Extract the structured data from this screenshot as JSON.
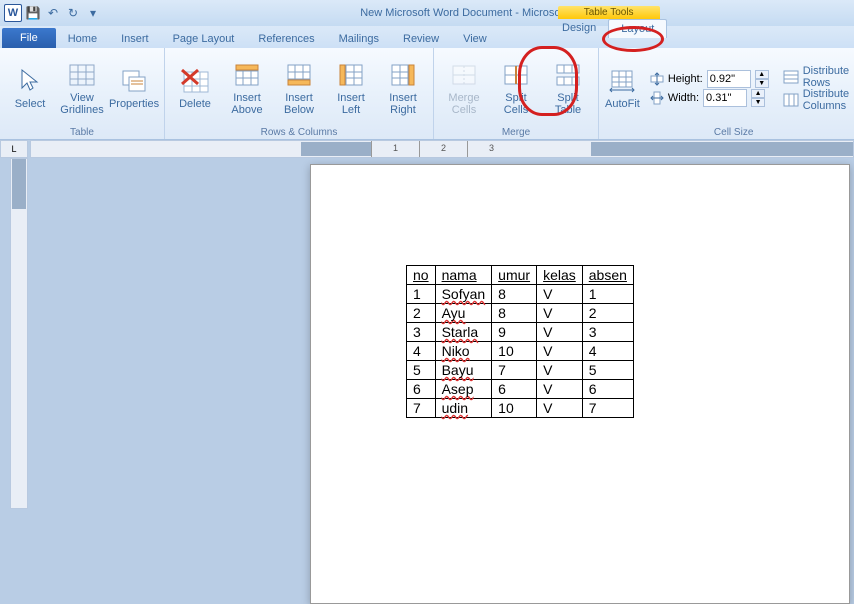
{
  "title": "New Microsoft Word Document  -  Microsoft Word",
  "context_tab_label": "Table Tools",
  "tabs": {
    "file": "File",
    "home": "Home",
    "insert": "Insert",
    "pagelayout": "Page Layout",
    "references": "References",
    "mailings": "Mailings",
    "review": "Review",
    "view": "View",
    "design": "Design",
    "layout": "Layout"
  },
  "ribbon": {
    "select": "Select",
    "gridlines": "View Gridlines",
    "properties": "Properties",
    "delete": "Delete",
    "ins_above": "Insert Above",
    "ins_below": "Insert Below",
    "ins_left": "Insert Left",
    "ins_right": "Insert Right",
    "merge": "Merge Cells",
    "split_cells": "Split Cells",
    "split_table": "Split Table",
    "autofit": "AutoFit",
    "height_lbl": "Height:",
    "width_lbl": "Width:",
    "height_val": "0.92\"",
    "width_val": "0.31\"",
    "dist_rows": "Distribute Rows",
    "dist_cols": "Distribute Columns",
    "g_table": "Table",
    "g_rows": "Rows & Columns",
    "g_merge": "Merge",
    "g_size": "Cell Size"
  },
  "ruler": {
    "t1": "1",
    "t2": "2",
    "t3": "3"
  },
  "doc": {
    "headers": [
      "no",
      "nama",
      "umur",
      "kelas",
      "absen"
    ],
    "rows": [
      [
        "1",
        "Sofyan",
        "8",
        "V",
        "1"
      ],
      [
        "2",
        "Ayu",
        "8",
        "V",
        "2"
      ],
      [
        "3",
        "Starla",
        "9",
        "V",
        "3"
      ],
      [
        "4",
        "Niko",
        "10",
        "V",
        "4"
      ],
      [
        "5",
        "Bayu",
        "7",
        "V",
        "5"
      ],
      [
        "6",
        "Asep",
        "6",
        "V",
        "6"
      ],
      [
        "7",
        "udin",
        "10",
        "V",
        "7"
      ]
    ]
  }
}
